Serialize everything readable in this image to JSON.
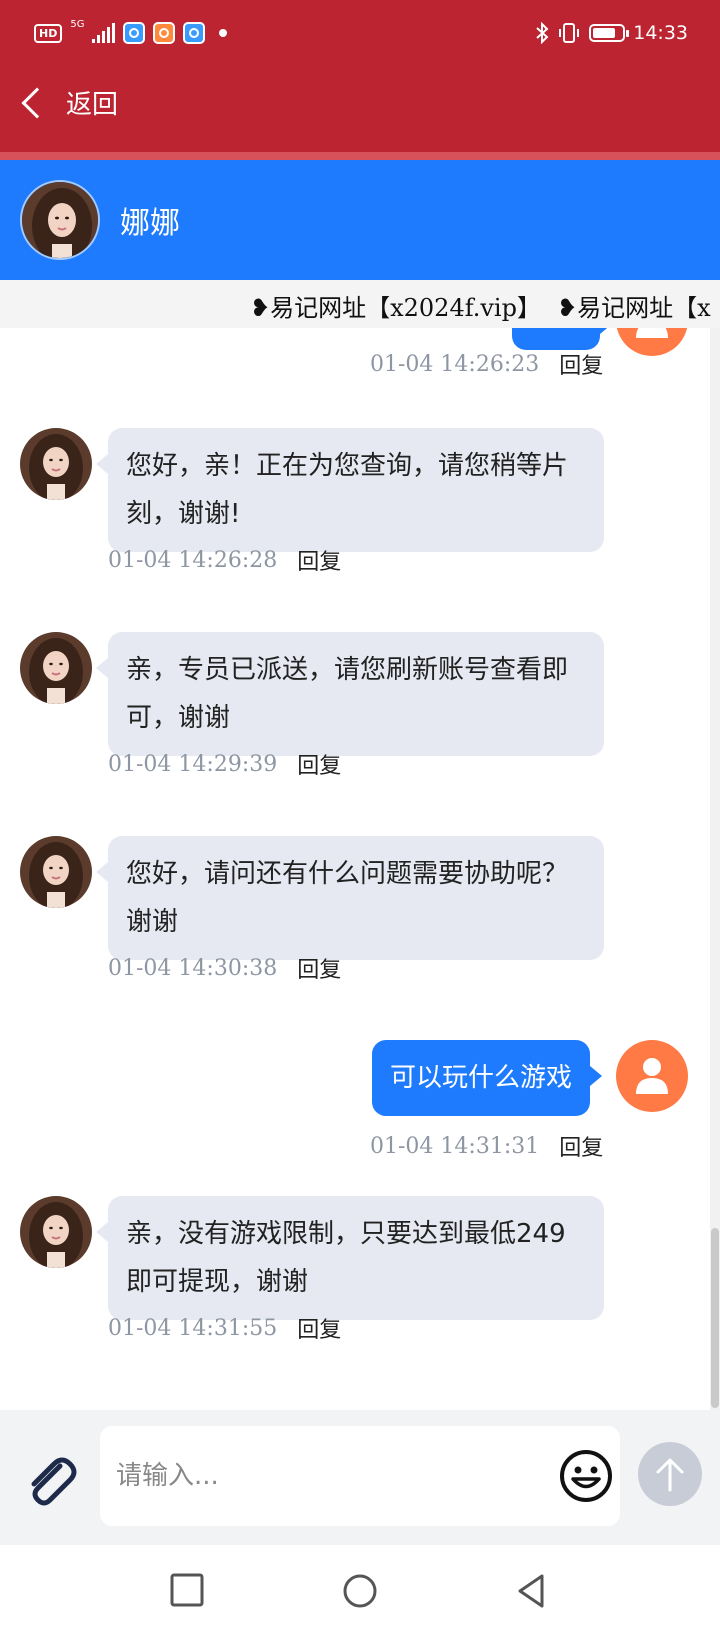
{
  "status_bar": {
    "hd": "HD",
    "network": "5G",
    "time": "14:33"
  },
  "nav": {
    "back_label": "返回"
  },
  "contact": {
    "name": "娜娜"
  },
  "notice": {
    "items": [
      "❥易记网址【x2024f.vip】",
      "❥易记网址【x"
    ]
  },
  "messages": [
    {
      "direction": "out",
      "text": "",
      "time": "01-04 14:26:23",
      "reply": "回复"
    },
    {
      "direction": "in",
      "text": "您好，亲！正在为您查询，请您稍等片刻，谢谢!",
      "time": "01-04 14:26:28",
      "reply": "回复"
    },
    {
      "direction": "in",
      "text": "亲，专员已派送，请您刷新账号查看即可，谢谢",
      "time": "01-04 14:29:39",
      "reply": "回复"
    },
    {
      "direction": "in",
      "text": "您好，请问还有什么问题需要协助呢？谢谢",
      "time": "01-04 14:30:38",
      "reply": "回复"
    },
    {
      "direction": "out",
      "text": "可以玩什么游戏",
      "time": "01-04 14:31:31",
      "reply": "回复"
    },
    {
      "direction": "in",
      "text": "亲，没有游戏限制，只要达到最低249即可提现，谢谢",
      "time": "01-04 14:31:55",
      "reply": "回复"
    }
  ],
  "composer": {
    "placeholder": "请输入...",
    "value": ""
  },
  "icons": {
    "back": "chevron-left-icon",
    "attach": "paperclip-icon",
    "emoji": "smiley-icon",
    "send": "arrow-up-icon",
    "user": "person-icon",
    "sys_recent": "square-icon",
    "sys_home": "circle-icon",
    "sys_back": "triangle-back-icon"
  },
  "colors": {
    "topbar": "#bb2430",
    "header": "#1f7bfd",
    "bubble_out": "#1f7bfd",
    "bubble_in": "#e6e9f1",
    "user_avatar": "#ff7a45"
  }
}
